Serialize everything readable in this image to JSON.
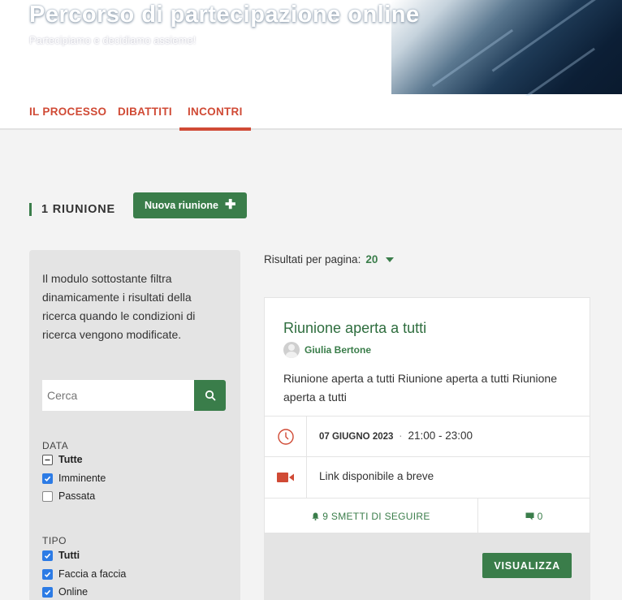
{
  "header": {
    "title": "Percorso di partecipazione online",
    "subtitle": "Partecipiamo e decidiamo assieme!"
  },
  "tabs": [
    {
      "label": "IL PROCESSO",
      "active": false
    },
    {
      "label": "DIBATTITI",
      "active": false
    },
    {
      "label": "INCONTRI",
      "active": true
    }
  ],
  "section": {
    "title": "1 RIUNIONE",
    "new_button": "Nuova riunione",
    "new_button_icon": "plus-icon"
  },
  "filters": {
    "description": "Il modulo sottostante filtra dinamicamente i risultati della ricerca quando le condizioni di ricerca vengono modificate.",
    "search_placeholder": "Cerca",
    "search_icon": "search-icon",
    "date": {
      "label": "DATA",
      "options": [
        {
          "label": "Tutte",
          "state": "indeterminate"
        },
        {
          "label": "Imminente",
          "state": "checked"
        },
        {
          "label": "Passata",
          "state": "unchecked"
        }
      ]
    },
    "type": {
      "label": "TIPO",
      "options": [
        {
          "label": "Tutti",
          "state": "checked"
        },
        {
          "label": "Faccia a faccia",
          "state": "checked"
        },
        {
          "label": "Online",
          "state": "checked"
        }
      ]
    }
  },
  "results": {
    "per_page_label": "Risultati per pagina:",
    "per_page_value": "20"
  },
  "meeting": {
    "title": "Riunione aperta a tutti",
    "author": "Giulia Bertone",
    "description": "Riunione aperta a tutti Riunione aperta a tutti Riunione aperta a tutti",
    "date": "07 GIUGNO 2023",
    "separator": "·",
    "time": "21:00 - 23:00",
    "link_text": "Link disponibile a breve",
    "follow_text": "9 SMETTI DI SEGUIRE",
    "comments_count": "0",
    "view_button": "VISUALIZZA"
  },
  "colors": {
    "accent_green": "#3a7d4a",
    "accent_red": "#d04a35",
    "checkbox_blue": "#2c7be5"
  }
}
